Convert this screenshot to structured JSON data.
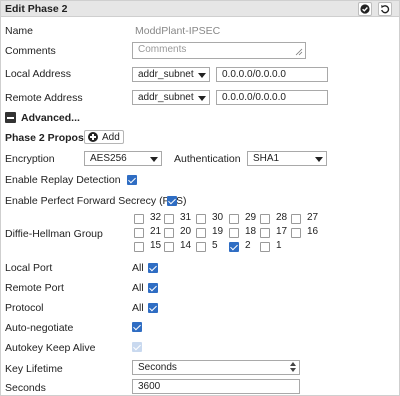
{
  "header": {
    "title": "Edit Phase 2",
    "apply_icon": "check-circle-icon",
    "reset_icon": "undo-icon"
  },
  "name": {
    "label": "Name",
    "value": "ModdPlant-IPSEC"
  },
  "comments": {
    "label": "Comments",
    "placeholder": "Comments"
  },
  "local_address": {
    "label": "Local Address",
    "type": "addr_subnet",
    "value": "0.0.0.0/0.0.0.0"
  },
  "remote_address": {
    "label": "Remote Address",
    "type": "addr_subnet",
    "value": "0.0.0.0/0.0.0.0"
  },
  "advanced": {
    "label": "Advanced..."
  },
  "proposal": {
    "label": "Phase 2 Proposal",
    "add_label": "Add"
  },
  "encryption": {
    "label": "Encryption",
    "value": "AES256"
  },
  "authentication": {
    "label": "Authentication",
    "value": "SHA1"
  },
  "replay": {
    "label": "Enable Replay Detection",
    "checked": true
  },
  "pfs": {
    "label": "Enable Perfect Forward Secrecy (PFS)",
    "checked": true
  },
  "dh": {
    "label": "Diffie-Hellman Group",
    "groups": [
      {
        "id": "32",
        "checked": false
      },
      {
        "id": "31",
        "checked": false
      },
      {
        "id": "30",
        "checked": false
      },
      {
        "id": "29",
        "checked": false
      },
      {
        "id": "28",
        "checked": false
      },
      {
        "id": "27",
        "checked": false
      },
      {
        "id": "21",
        "checked": false
      },
      {
        "id": "20",
        "checked": false
      },
      {
        "id": "19",
        "checked": false
      },
      {
        "id": "18",
        "checked": false
      },
      {
        "id": "17",
        "checked": false
      },
      {
        "id": "16",
        "checked": false
      },
      {
        "id": "15",
        "checked": false
      },
      {
        "id": "14",
        "checked": false
      },
      {
        "id": "5",
        "checked": false
      },
      {
        "id": "2",
        "checked": true
      },
      {
        "id": "1",
        "checked": false
      }
    ]
  },
  "local_port": {
    "label": "Local Port",
    "value": "All",
    "checked": true
  },
  "remote_port": {
    "label": "Remote Port",
    "value": "All",
    "checked": true
  },
  "protocol": {
    "label": "Protocol",
    "value": "All",
    "checked": true
  },
  "auto_negotiate": {
    "label": "Auto-negotiate",
    "checked": true
  },
  "autokey": {
    "label": "Autokey Keep Alive",
    "checked": true,
    "disabled": true
  },
  "key_lifetime": {
    "label": "Key Lifetime",
    "value": "Seconds"
  },
  "seconds": {
    "label": "Seconds",
    "value": "3600"
  },
  "colors": {
    "accent": "#2f6dc3",
    "header_bg": "#e6e6e6"
  }
}
